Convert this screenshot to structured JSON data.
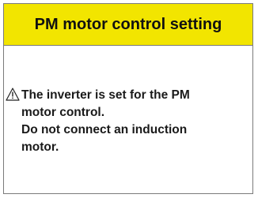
{
  "header": {
    "title": "PM motor control setting",
    "background": "#f2e500"
  },
  "warning": {
    "icon": "warning-triangle-icon",
    "lines": [
      "The inverter is set for the PM",
      "motor control.",
      "Do not connect an induction",
      "motor."
    ]
  }
}
